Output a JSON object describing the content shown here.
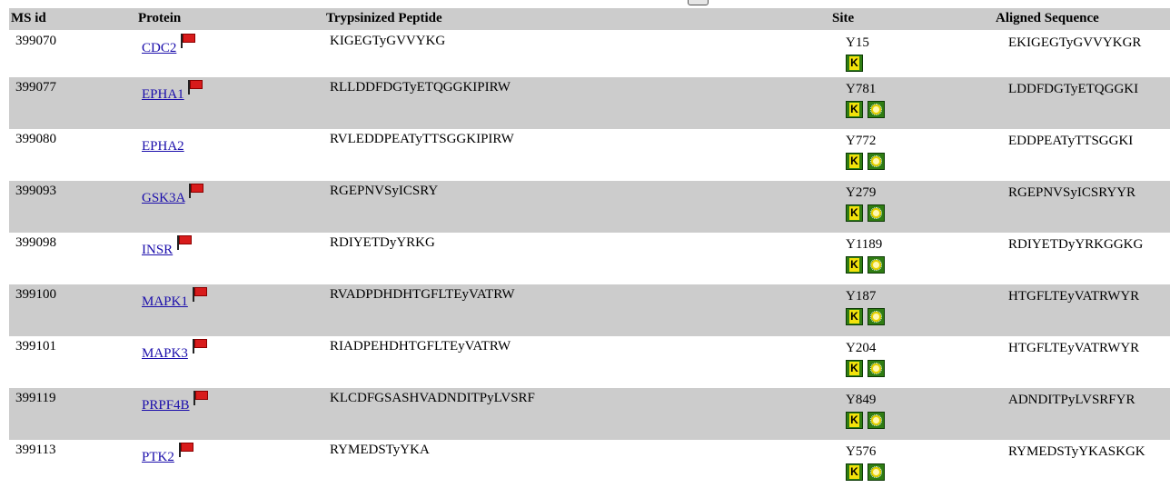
{
  "header": {
    "msid": "MS id",
    "protein": "Protein",
    "peptide": "Trypsinized Peptide",
    "site": "Site",
    "aligned": "Aligned Sequence"
  },
  "icons": {
    "kinase_badge": "K",
    "flag_icon": "flag-icon",
    "sun_icon": "sun-icon",
    "flag_color": "#d81b1b",
    "badge_color": "#2f7d12"
  },
  "rows": [
    {
      "msid": "399070",
      "protein": "CDC2",
      "flag": true,
      "peptide": "KIGEGTyGVVYKG",
      "site": "Y15",
      "sun": false,
      "aligned": "EKIGEGTyGVVYKGR"
    },
    {
      "msid": "399077",
      "protein": "EPHA1",
      "flag": true,
      "peptide": "RLLDDFDGTyETQGGKIPIRW",
      "site": "Y781",
      "sun": true,
      "aligned": "LDDFDGTyETQGGKI"
    },
    {
      "msid": "399080",
      "protein": "EPHA2",
      "flag": false,
      "peptide": "RVLEDDPEATyTTSGGKIPIRW",
      "site": "Y772",
      "sun": true,
      "aligned": "EDDPEATyTTSGGKI"
    },
    {
      "msid": "399093",
      "protein": "GSK3A",
      "flag": true,
      "peptide": "RGEPNVSyICSRY",
      "site": "Y279",
      "sun": true,
      "aligned": "RGEPNVSyICSRYYR"
    },
    {
      "msid": "399098",
      "protein": "INSR",
      "flag": true,
      "peptide": "RDIYETDyYRKG",
      "site": "Y1189",
      "sun": true,
      "aligned": "RDIYETDyYRKGGKG"
    },
    {
      "msid": "399100",
      "protein": "MAPK1",
      "flag": true,
      "peptide": "RVADPDHDHTGFLTEyVATRW",
      "site": "Y187",
      "sun": true,
      "aligned": "HTGFLTEyVATRWYR"
    },
    {
      "msid": "399101",
      "protein": "MAPK3",
      "flag": true,
      "peptide": "RIADPEHDHTGFLTEyVATRW",
      "site": "Y204",
      "sun": true,
      "aligned": "HTGFLTEyVATRWYR"
    },
    {
      "msid": "399119",
      "protein": "PRPF4B",
      "flag": true,
      "peptide": "KLCDFGSASHVADNDITPyLVSRF",
      "site": "Y849",
      "sun": true,
      "aligned": "ADNDITPyLVSRFYR"
    },
    {
      "msid": "399113",
      "protein": "PTK2",
      "flag": true,
      "peptide": "RYMEDSTyYKA",
      "site": "Y576",
      "sun": true,
      "aligned": "RYMEDSTyYKASKGK"
    }
  ]
}
